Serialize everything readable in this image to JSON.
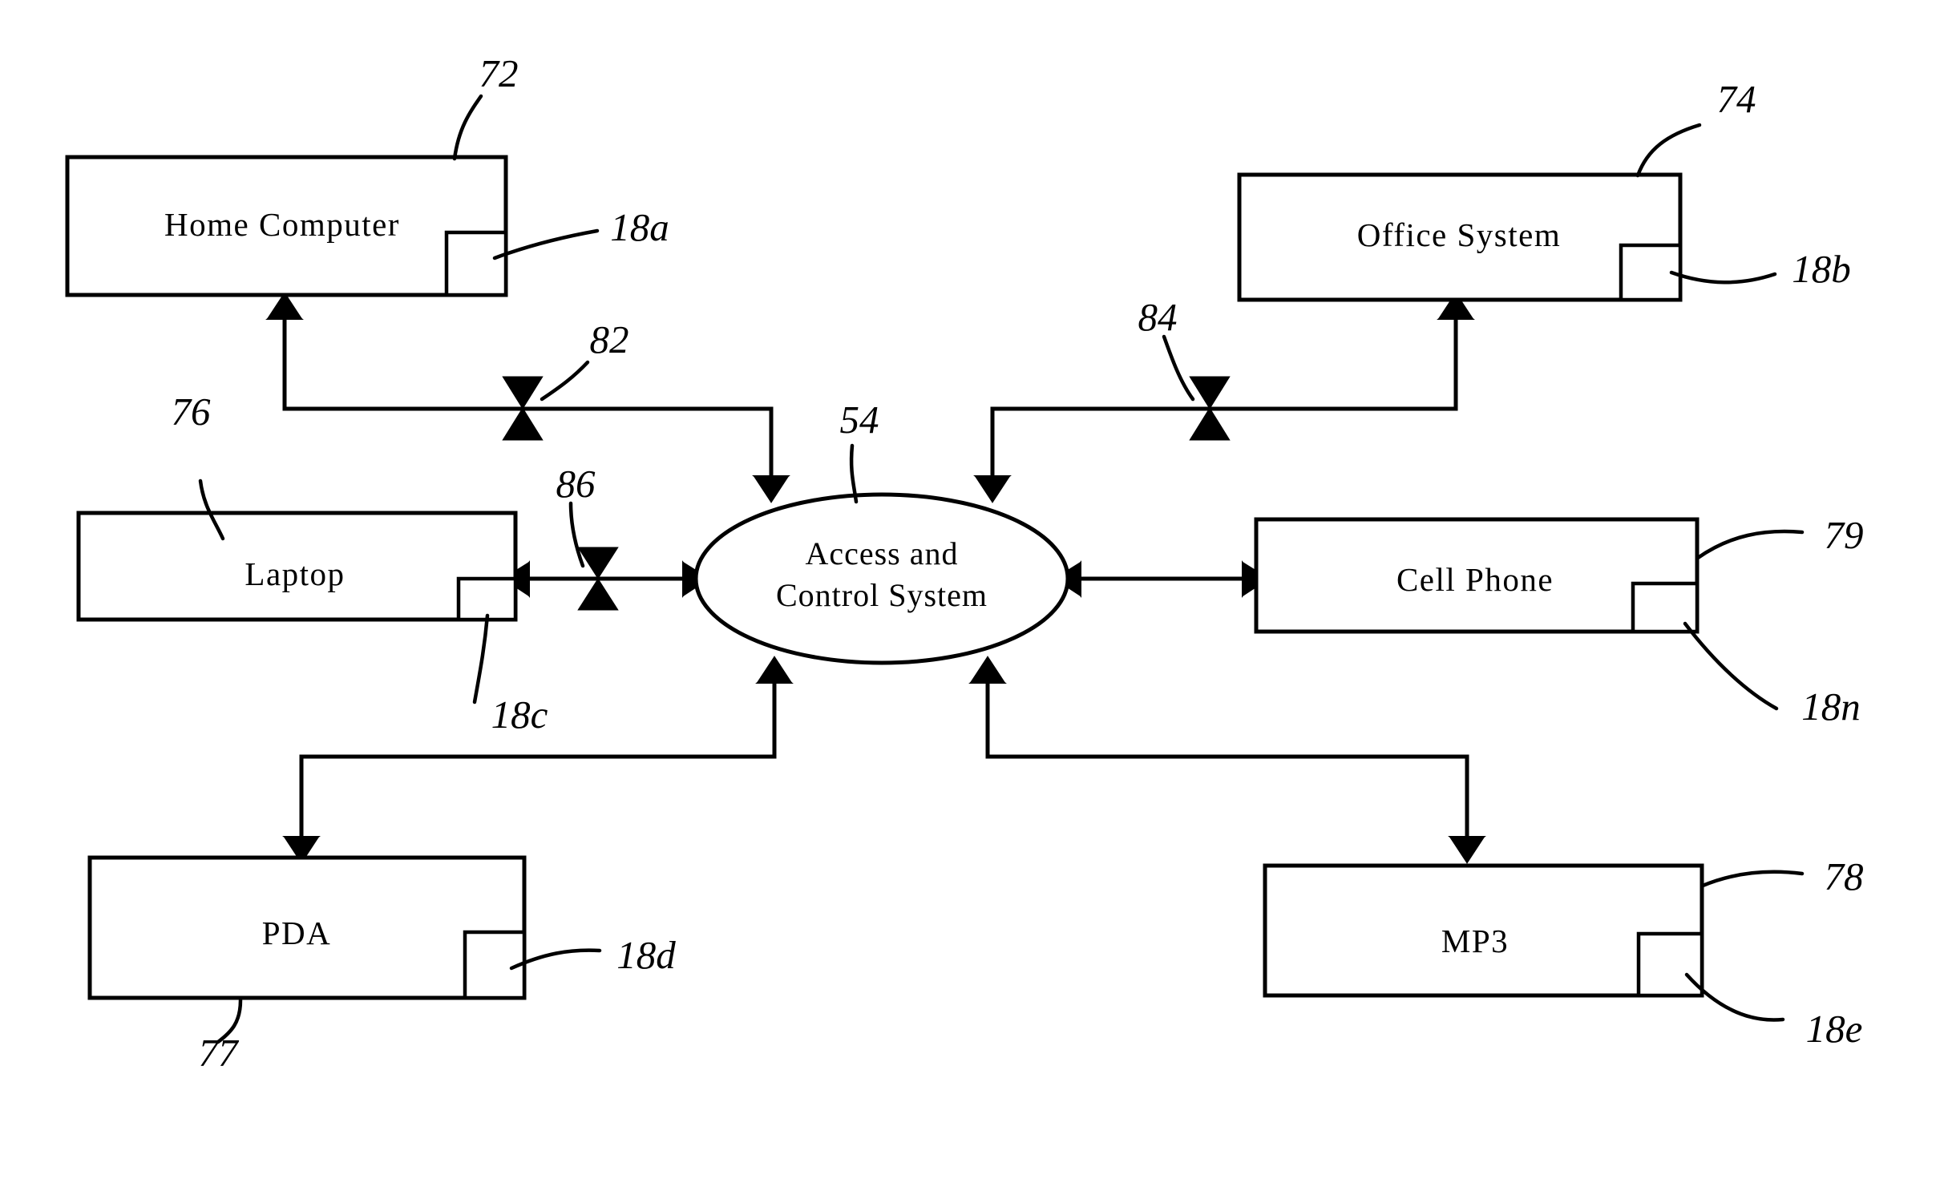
{
  "figure": {
    "type": "patent-block-diagram",
    "background": "#ffffff",
    "line_color": "#000000"
  },
  "nodes": {
    "home_computer": {
      "label": "Home Computer",
      "ref": "72",
      "port_ref": "18a"
    },
    "office_system": {
      "label": "Office System",
      "ref": "74",
      "port_ref": "18b"
    },
    "laptop": {
      "label": "Laptop",
      "ref": "76",
      "port_ref": "18c"
    },
    "cell_phone": {
      "label": "Cell Phone",
      "ref": "79",
      "port_ref": "18n"
    },
    "pda": {
      "label": "PDA",
      "ref": "77",
      "port_ref": "18d"
    },
    "mp3": {
      "label": "MP3",
      "ref": "78",
      "port_ref": "18e"
    },
    "hub": {
      "label_line1": "Access and",
      "label_line2": "Control System",
      "ref": "54"
    }
  },
  "valves": {
    "home_link": {
      "ref": "82"
    },
    "office_link": {
      "ref": "84"
    },
    "laptop_link": {
      "ref": "86"
    }
  },
  "reference_numerals": [
    {
      "id": "ref-72",
      "text": "72",
      "target": "home_computer"
    },
    {
      "id": "ref-74",
      "text": "74",
      "target": "office_system"
    },
    {
      "id": "ref-76",
      "text": "76",
      "target": "laptop"
    },
    {
      "id": "ref-77",
      "text": "77",
      "target": "pda"
    },
    {
      "id": "ref-78",
      "text": "78",
      "target": "mp3"
    },
    {
      "id": "ref-79",
      "text": "79",
      "target": "cell_phone"
    },
    {
      "id": "ref-54",
      "text": "54",
      "target": "hub"
    },
    {
      "id": "ref-82",
      "text": "82",
      "target": "valve-home"
    },
    {
      "id": "ref-84",
      "text": "84",
      "target": "valve-office"
    },
    {
      "id": "ref-86",
      "text": "86",
      "target": "valve-laptop"
    },
    {
      "id": "ref-18a",
      "text": "18a",
      "target": "home_computer_port"
    },
    {
      "id": "ref-18b",
      "text": "18b",
      "target": "office_system_port"
    },
    {
      "id": "ref-18c",
      "text": "18c",
      "target": "laptop_port"
    },
    {
      "id": "ref-18d",
      "text": "18d",
      "target": "pda_port"
    },
    {
      "id": "ref-18e",
      "text": "18e",
      "target": "mp3_port"
    },
    {
      "id": "ref-18n",
      "text": "18n",
      "target": "cell_phone_port"
    }
  ]
}
